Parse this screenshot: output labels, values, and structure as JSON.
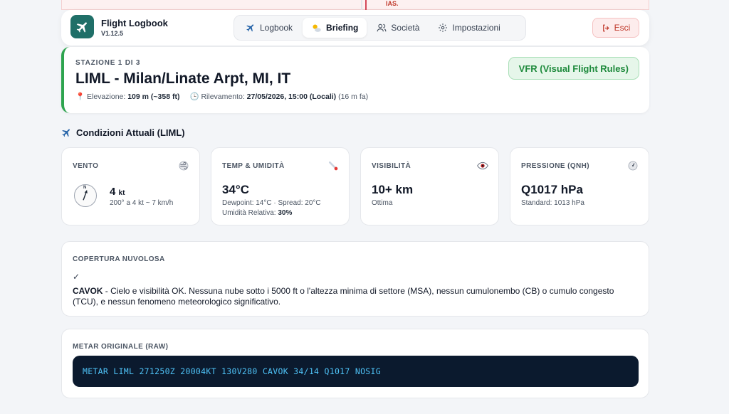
{
  "background_alert": {
    "text": "IAS."
  },
  "app": {
    "title": "Flight Logbook",
    "version": "V1.12.5"
  },
  "nav": [
    {
      "label": "Logbook",
      "icon": "plane-icon",
      "active": false
    },
    {
      "label": "Briefing",
      "icon": "sun-cloud-icon",
      "active": true
    },
    {
      "label": "Società",
      "icon": "users-icon",
      "active": false
    },
    {
      "label": "Impostazioni",
      "icon": "gear-icon",
      "active": false
    }
  ],
  "logout": {
    "label": "Esci",
    "icon": "logout-icon"
  },
  "station": {
    "kicker": "STAZIONE 1 DI 3",
    "name": "LIML - Milan/Linate Arpt, MI, IT",
    "elevation_label": "Elevazione:",
    "elevation_value": "109 m (~358 ft)",
    "observed_label": "Rilevamento:",
    "observed_value": "27/05/2026, 15:00 (Locali)",
    "observed_ago": "(16 m fa)",
    "flight_rules": "VFR (Visual Flight Rules)"
  },
  "section": {
    "title": "Condizioni Attuali (LIML)"
  },
  "wind": {
    "label": "VENTO",
    "value": "4",
    "unit": "kt",
    "detail": "200° a 4 kt ~ 7 km/h",
    "direction_deg": 200,
    "icon": "wind-icon"
  },
  "temperature": {
    "label": "TEMP & UMIDITÀ",
    "value": "34°C",
    "detail": "Dewpoint: 14°C · Spread: 20°C",
    "humidity_label": "Umidità Relativa:",
    "humidity_value": "30%",
    "icon": "thermometer-icon"
  },
  "visibility": {
    "label": "VISIBILITÀ",
    "value": "10+ km",
    "detail": "Ottima",
    "icon": "eye-icon"
  },
  "pressure": {
    "label": "PRESSIONE (QNH)",
    "value": "Q1017 hPa",
    "detail": "Standard: 1013 hPa",
    "icon": "gauge-icon"
  },
  "clouds": {
    "label": "COPERTURA NUVOLOSA",
    "check": "✓",
    "code": "CAVOK",
    "text": " - Cielo e visibilità OK. Nessuna nube sotto i 5000 ft o l'altezza minima di settore (MSA), nessun cumulonembo (CB) o cumulo congesto (TCU), e nessun fenomeno meteorologico significativo."
  },
  "metar": {
    "label": "METAR ORIGINALE (RAW)",
    "raw": "METAR LIML 271250Z 20004KT 130V280 CAVOK 34/14 Q1017 NOSIG"
  },
  "colors": {
    "accent_green": "#2ea44f",
    "logout_red": "#c0392b",
    "brand_teal": "#1f6f68",
    "metar_bg": "#0b1a2e",
    "metar_text": "#4fc3f7"
  }
}
